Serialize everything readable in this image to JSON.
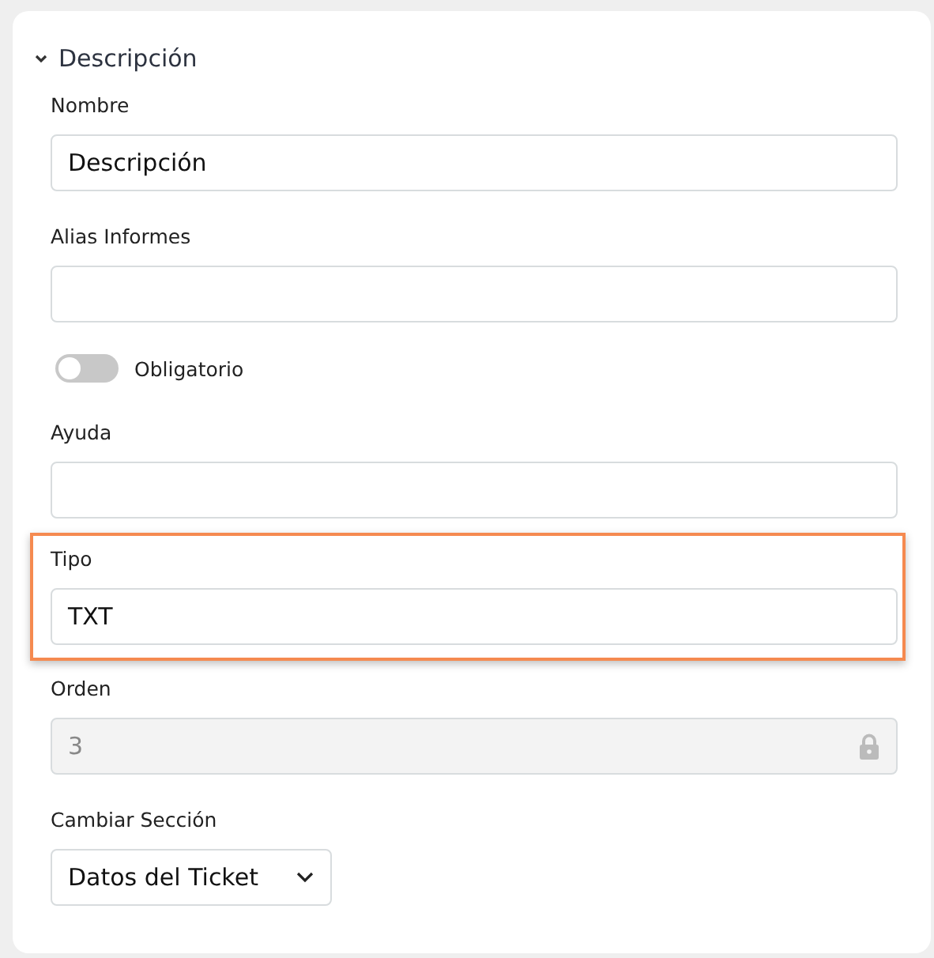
{
  "section": {
    "title": "Descripción",
    "expanded": true
  },
  "fields": [
    {
      "kind": "text",
      "label": "Nombre",
      "value": "Descripción",
      "highlighted": false
    },
    {
      "kind": "text",
      "label": "Alias Informes",
      "highlighted": false
    },
    {
      "kind": "toggle",
      "label": "Obligatorio",
      "on": false
    },
    {
      "kind": "text",
      "label": "Ayuda",
      "highlighted": false
    },
    {
      "kind": "text",
      "label": "Tipo",
      "value": "TXT",
      "highlighted": true
    },
    {
      "kind": "locked",
      "label": "Orden",
      "value": "3",
      "highlighted": false
    },
    {
      "kind": "select",
      "label": "Cambiar Sección",
      "value": "Datos del Ticket",
      "highlighted": false
    }
  ]
}
